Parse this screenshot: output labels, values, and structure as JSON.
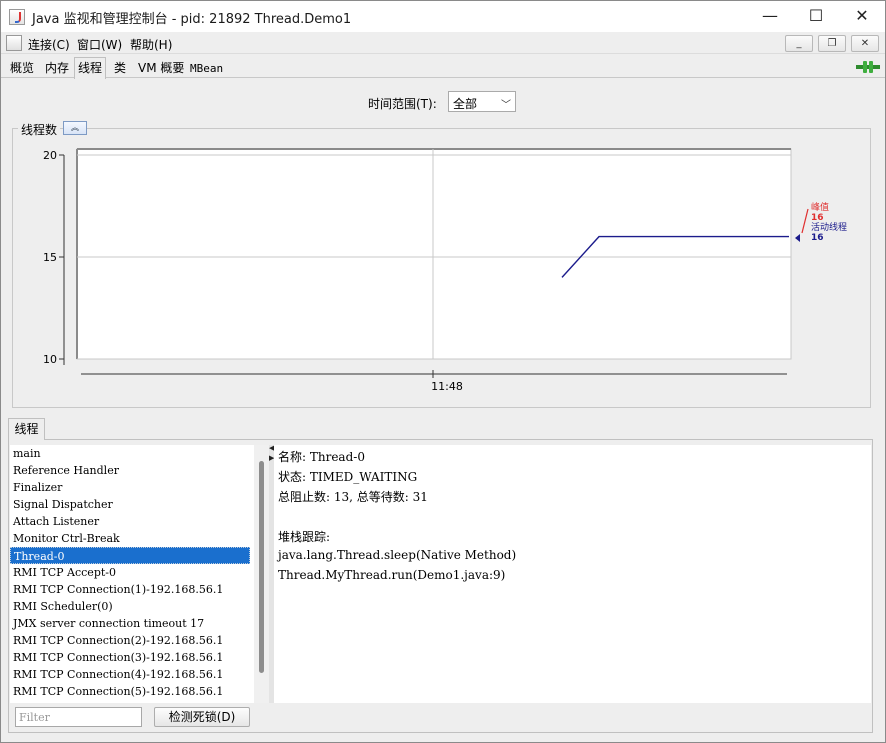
{
  "window": {
    "title": "Java 监视和管理控制台 - pid: 21892 Thread.Demo1",
    "minimize_glyph": "—",
    "maximize_glyph": "☐",
    "close_glyph": "✕"
  },
  "menubar": {
    "items": [
      "连接(C)",
      "窗口(W)",
      "帮助(H)"
    ],
    "mdi_minimize": "_",
    "mdi_restore": "❐",
    "mdi_close": "✕"
  },
  "tabs": [
    {
      "label": "概览",
      "active": false
    },
    {
      "label": "内存",
      "active": false
    },
    {
      "label": "线程",
      "active": true
    },
    {
      "label": "类",
      "active": false
    },
    {
      "label": "VM 概要",
      "active": false
    },
    {
      "label": "MBean",
      "active": false
    }
  ],
  "time_range": {
    "label": "时间范围(T):",
    "selected": "全部"
  },
  "chart_panel": {
    "title": "线程数",
    "collapse_glyph": "︽"
  },
  "chart_data": {
    "type": "line",
    "title": "线程数",
    "xlabel": "",
    "ylabel": "",
    "ylim": [
      10,
      20
    ],
    "yticks": [
      10,
      15,
      20
    ],
    "xticks": [
      "11:48"
    ],
    "series": [
      {
        "name": "峰值",
        "color": "#e03030",
        "latest": 16
      },
      {
        "name": "活动线程",
        "color": "#1c1c8c",
        "latest": 16,
        "values": [
          14,
          16,
          16
        ]
      }
    ]
  },
  "threads": {
    "tab_label": "线程",
    "list": [
      "main",
      "Reference Handler",
      "Finalizer",
      "Signal Dispatcher",
      "Attach Listener",
      "Monitor Ctrl-Break",
      "Thread-0",
      "RMI TCP Accept-0",
      "RMI TCP Connection(1)-192.168.56.1",
      "RMI Scheduler(0)",
      "JMX server connection timeout 17",
      "RMI TCP Connection(2)-192.168.56.1",
      "RMI TCP Connection(3)-192.168.56.1",
      "RMI TCP Connection(4)-192.168.56.1",
      "RMI TCP Connection(5)-192.168.56.1"
    ],
    "selected_index": 6,
    "details": {
      "name_line": "名称: Thread-0",
      "state_line": "状态: TIMED_WAITING",
      "counts_line": "总阻止数: 13, 总等待数: 31",
      "stack_label": "堆栈跟踪:",
      "stack": [
        "java.lang.Thread.sleep(Native Method)",
        "Thread.MyThread.run(Demo1.java:9)"
      ]
    },
    "filter_placeholder": "Filter",
    "deadlock_button": "检测死锁(D)"
  }
}
